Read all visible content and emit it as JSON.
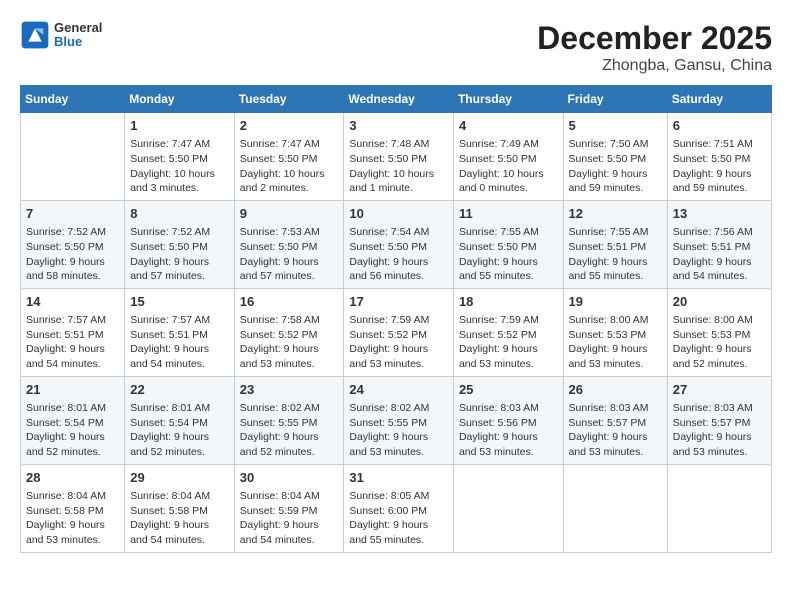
{
  "header": {
    "logo_general": "General",
    "logo_blue": "Blue",
    "title": "December 2025",
    "subtitle": "Zhongba, Gansu, China"
  },
  "calendar": {
    "days_of_week": [
      "Sunday",
      "Monday",
      "Tuesday",
      "Wednesday",
      "Thursday",
      "Friday",
      "Saturday"
    ],
    "weeks": [
      [
        {
          "day": "",
          "content": ""
        },
        {
          "day": "1",
          "content": "Sunrise: 7:47 AM\nSunset: 5:50 PM\nDaylight: 10 hours\nand 3 minutes."
        },
        {
          "day": "2",
          "content": "Sunrise: 7:47 AM\nSunset: 5:50 PM\nDaylight: 10 hours\nand 2 minutes."
        },
        {
          "day": "3",
          "content": "Sunrise: 7:48 AM\nSunset: 5:50 PM\nDaylight: 10 hours\nand 1 minute."
        },
        {
          "day": "4",
          "content": "Sunrise: 7:49 AM\nSunset: 5:50 PM\nDaylight: 10 hours\nand 0 minutes."
        },
        {
          "day": "5",
          "content": "Sunrise: 7:50 AM\nSunset: 5:50 PM\nDaylight: 9 hours\nand 59 minutes."
        },
        {
          "day": "6",
          "content": "Sunrise: 7:51 AM\nSunset: 5:50 PM\nDaylight: 9 hours\nand 59 minutes."
        }
      ],
      [
        {
          "day": "7",
          "content": "Sunrise: 7:52 AM\nSunset: 5:50 PM\nDaylight: 9 hours\nand 58 minutes."
        },
        {
          "day": "8",
          "content": "Sunrise: 7:52 AM\nSunset: 5:50 PM\nDaylight: 9 hours\nand 57 minutes."
        },
        {
          "day": "9",
          "content": "Sunrise: 7:53 AM\nSunset: 5:50 PM\nDaylight: 9 hours\nand 57 minutes."
        },
        {
          "day": "10",
          "content": "Sunrise: 7:54 AM\nSunset: 5:50 PM\nDaylight: 9 hours\nand 56 minutes."
        },
        {
          "day": "11",
          "content": "Sunrise: 7:55 AM\nSunset: 5:50 PM\nDaylight: 9 hours\nand 55 minutes."
        },
        {
          "day": "12",
          "content": "Sunrise: 7:55 AM\nSunset: 5:51 PM\nDaylight: 9 hours\nand 55 minutes."
        },
        {
          "day": "13",
          "content": "Sunrise: 7:56 AM\nSunset: 5:51 PM\nDaylight: 9 hours\nand 54 minutes."
        }
      ],
      [
        {
          "day": "14",
          "content": "Sunrise: 7:57 AM\nSunset: 5:51 PM\nDaylight: 9 hours\nand 54 minutes."
        },
        {
          "day": "15",
          "content": "Sunrise: 7:57 AM\nSunset: 5:51 PM\nDaylight: 9 hours\nand 54 minutes."
        },
        {
          "day": "16",
          "content": "Sunrise: 7:58 AM\nSunset: 5:52 PM\nDaylight: 9 hours\nand 53 minutes."
        },
        {
          "day": "17",
          "content": "Sunrise: 7:59 AM\nSunset: 5:52 PM\nDaylight: 9 hours\nand 53 minutes."
        },
        {
          "day": "18",
          "content": "Sunrise: 7:59 AM\nSunset: 5:52 PM\nDaylight: 9 hours\nand 53 minutes."
        },
        {
          "day": "19",
          "content": "Sunrise: 8:00 AM\nSunset: 5:53 PM\nDaylight: 9 hours\nand 53 minutes."
        },
        {
          "day": "20",
          "content": "Sunrise: 8:00 AM\nSunset: 5:53 PM\nDaylight: 9 hours\nand 52 minutes."
        }
      ],
      [
        {
          "day": "21",
          "content": "Sunrise: 8:01 AM\nSunset: 5:54 PM\nDaylight: 9 hours\nand 52 minutes."
        },
        {
          "day": "22",
          "content": "Sunrise: 8:01 AM\nSunset: 5:54 PM\nDaylight: 9 hours\nand 52 minutes."
        },
        {
          "day": "23",
          "content": "Sunrise: 8:02 AM\nSunset: 5:55 PM\nDaylight: 9 hours\nand 52 minutes."
        },
        {
          "day": "24",
          "content": "Sunrise: 8:02 AM\nSunset: 5:55 PM\nDaylight: 9 hours\nand 53 minutes."
        },
        {
          "day": "25",
          "content": "Sunrise: 8:03 AM\nSunset: 5:56 PM\nDaylight: 9 hours\nand 53 minutes."
        },
        {
          "day": "26",
          "content": "Sunrise: 8:03 AM\nSunset: 5:57 PM\nDaylight: 9 hours\nand 53 minutes."
        },
        {
          "day": "27",
          "content": "Sunrise: 8:03 AM\nSunset: 5:57 PM\nDaylight: 9 hours\nand 53 minutes."
        }
      ],
      [
        {
          "day": "28",
          "content": "Sunrise: 8:04 AM\nSunset: 5:58 PM\nDaylight: 9 hours\nand 53 minutes."
        },
        {
          "day": "29",
          "content": "Sunrise: 8:04 AM\nSunset: 5:58 PM\nDaylight: 9 hours\nand 54 minutes."
        },
        {
          "day": "30",
          "content": "Sunrise: 8:04 AM\nSunset: 5:59 PM\nDaylight: 9 hours\nand 54 minutes."
        },
        {
          "day": "31",
          "content": "Sunrise: 8:05 AM\nSunset: 6:00 PM\nDaylight: 9 hours\nand 55 minutes."
        },
        {
          "day": "",
          "content": ""
        },
        {
          "day": "",
          "content": ""
        },
        {
          "day": "",
          "content": ""
        }
      ]
    ]
  }
}
